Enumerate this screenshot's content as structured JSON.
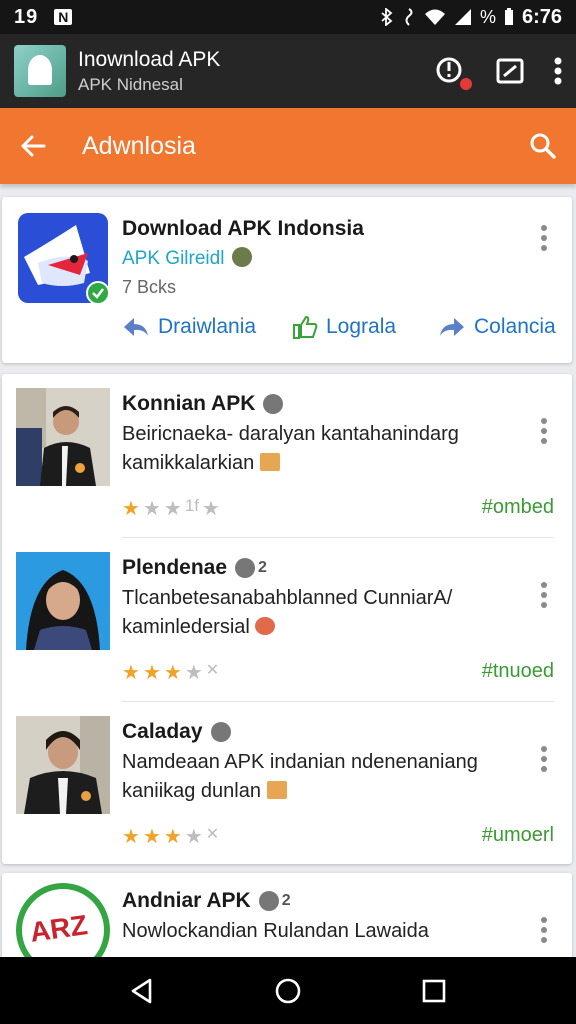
{
  "status": {
    "time": "19",
    "notif_icon": "N",
    "signal_text": "%",
    "clock": "6:76"
  },
  "app_bar": {
    "title": "Inownload APK",
    "subtitle": "APK Nidnesal"
  },
  "toolbar": {
    "title": "Adwnlosia"
  },
  "featured": {
    "title": "Download APK Indonsia",
    "developer": "APK Gilreidl",
    "info": "7 Bcks",
    "actions": [
      {
        "label": "Draiwlania",
        "icon": "reply-icon"
      },
      {
        "label": "Lograla",
        "icon": "thumb-up-icon"
      },
      {
        "label": "Colancia",
        "icon": "share-icon"
      }
    ]
  },
  "items": [
    {
      "name": "Konnian APK",
      "badge": "",
      "description_line1": "Beiricnaeka- daralyan kantahanindarg",
      "description_line2": "kamikkalarkian",
      "rating": 1,
      "extra_rating_text": "1f",
      "tag": "#ombed"
    },
    {
      "name": "Plendenae",
      "badge": "2",
      "description_line1": "Tlcanbetesanabahblanned CunniarA/",
      "description_line2": "kaminledersial",
      "rating": 3,
      "extra_rating_text": "",
      "tag": "#tnuoed"
    },
    {
      "name": "Caladay",
      "badge": "",
      "description_line1": "Namdeaan APK indanian ndenenaniang",
      "description_line2": "kaniikag dunlan",
      "rating": 3,
      "extra_rating_text": "",
      "tag": "#umoerl"
    }
  ],
  "partial_item": {
    "name": "Andniar APK",
    "badge": "2",
    "description_line1": "Nowlockandian Rulandan Lawaida",
    "logo_text": "ARZ"
  },
  "colors": {
    "accent": "#f1762f",
    "link": "#1f73c8",
    "tag": "#3a9a33",
    "star": "#f0a326"
  }
}
